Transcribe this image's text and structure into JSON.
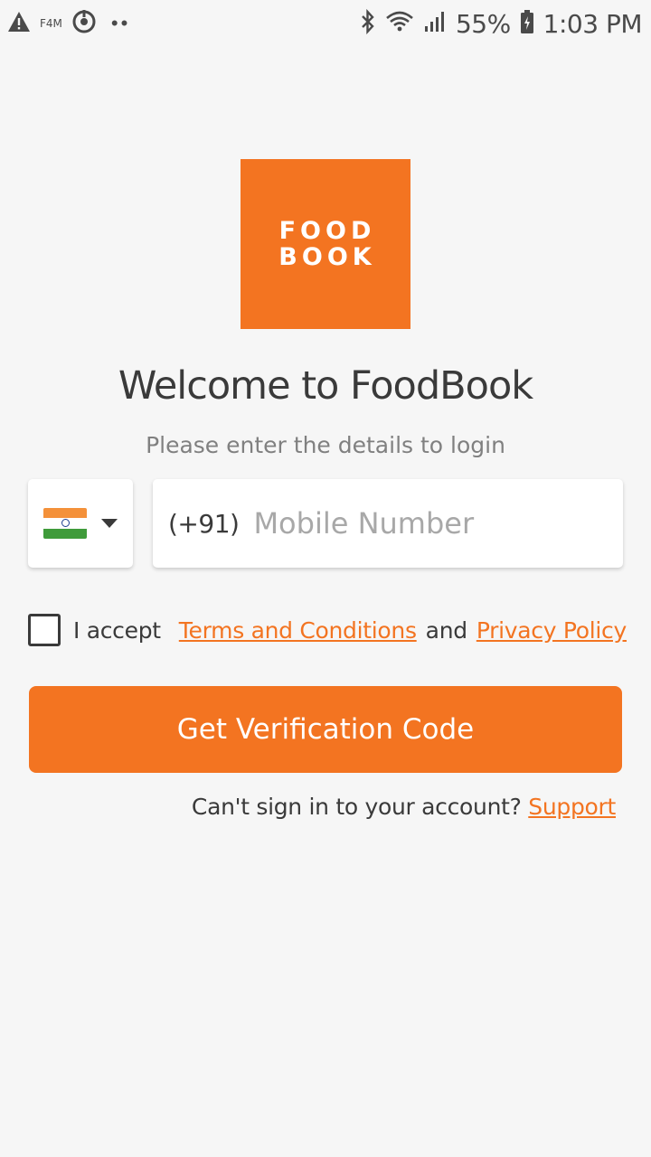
{
  "status_bar": {
    "left_label": "F4M",
    "dots": "••",
    "battery": "55%",
    "time": "1:03 PM",
    "icons": [
      "warning-icon",
      "sync-icon",
      "bluetooth-icon",
      "wifi-icon",
      "signal-icon",
      "battery-icon"
    ]
  },
  "logo": {
    "line1": "FOOD",
    "line2": "BOOK",
    "color": "#f37421"
  },
  "header": {
    "title": "Welcome to FoodBook",
    "subtitle": "Please enter the details to login"
  },
  "country": {
    "flag": "india-flag-icon"
  },
  "mobile": {
    "prefix": "(+91)",
    "placeholder": "Mobile Number",
    "value": ""
  },
  "terms": {
    "checked": false,
    "prefix": "I accept",
    "terms_link": "Terms and Conditions",
    "and": "and",
    "privacy_link": "Privacy Policy"
  },
  "cta": {
    "label": "Get Verification Code"
  },
  "support": {
    "question": "Can't sign in to your account?",
    "link": "Support"
  },
  "colors": {
    "accent": "#f37421",
    "background": "#f6f6f6",
    "text": "#3a3a3a"
  }
}
